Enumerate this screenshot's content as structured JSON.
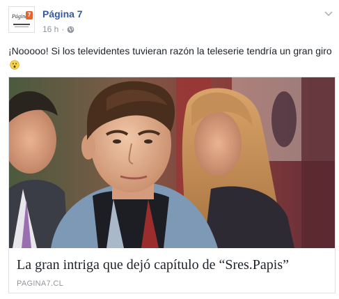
{
  "header": {
    "page_name": "Página 7",
    "avatar_text": "Página",
    "avatar_badge": "7",
    "time": "16 h",
    "separator": "·",
    "icons": {
      "privacy": "globe-icon",
      "menu": "chevron-down-icon"
    }
  },
  "post": {
    "text": "¡Nooooo! Si los televidentes tuvieran razón la teleserie tendría un gran giro",
    "emoji": "surprised-face-icon"
  },
  "link_card": {
    "title": "La gran intriga que dejó capítulo de “Sres.Papis”",
    "domain": "PAGINA7.CL"
  },
  "colors": {
    "link_blue": "#365899",
    "meta_gray": "#90949c",
    "text": "#1d2129",
    "border": "#dddfe2",
    "brand_orange": "#e8632b"
  }
}
